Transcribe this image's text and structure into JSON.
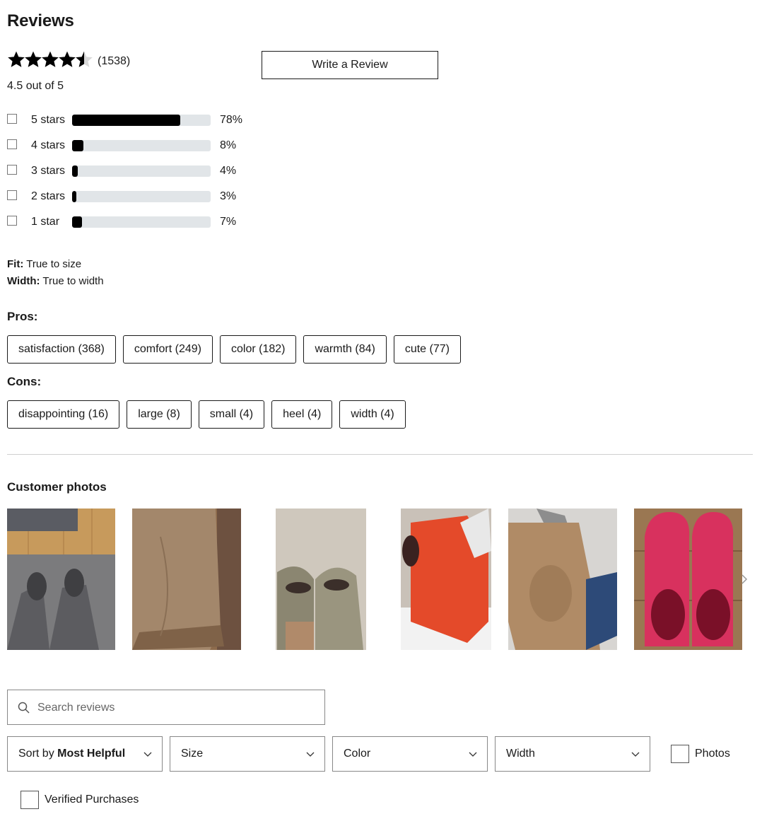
{
  "reviews": {
    "title": "Reviews",
    "rating_value": 4.5,
    "rating_count": "(1538)",
    "out_of": "4.5 out of 5",
    "write_review": "Write a Review",
    "distribution": [
      {
        "label": "5 stars",
        "percent": 78,
        "percent_text": "78%"
      },
      {
        "label": "4 stars",
        "percent": 8,
        "percent_text": "8%"
      },
      {
        "label": "3 stars",
        "percent": 4,
        "percent_text": "4%"
      },
      {
        "label": "2 stars",
        "percent": 3,
        "percent_text": "3%"
      },
      {
        "label": "1 star",
        "percent": 7,
        "percent_text": "7%"
      }
    ],
    "fit_label": "Fit:",
    "fit_value": "True to size",
    "width_label": "Width:",
    "width_value": "True to width",
    "pros_title": "Pros:",
    "pros": [
      "satisfaction (368)",
      "comfort (249)",
      "color (182)",
      "warmth (84)",
      "cute (77)"
    ],
    "cons_title": "Cons:",
    "cons": [
      "disappointing (16)",
      "large (8)",
      "small (4)",
      "heel (4)",
      "width (4)"
    ]
  },
  "photos": {
    "title": "Customer photos",
    "items": [
      {
        "name": "grey boots on wood and carpet floor"
      },
      {
        "name": "tan boot in box"
      },
      {
        "name": "silver boots worn"
      },
      {
        "name": "red orange boot"
      },
      {
        "name": "chestnut boot worn with jeans"
      },
      {
        "name": "pink boots top view"
      }
    ]
  },
  "filters": {
    "search_placeholder": "Search reviews",
    "sort_prefix": "Sort by ",
    "sort_value": "Most Helpful",
    "size": "Size",
    "color": "Color",
    "width": "Width",
    "photos_label": "Photos",
    "verified_label": "Verified Purchases"
  },
  "colors": {
    "bar_fill": "#000000",
    "bar_track": "#e1e5e8",
    "text": "#1a1a1a"
  }
}
